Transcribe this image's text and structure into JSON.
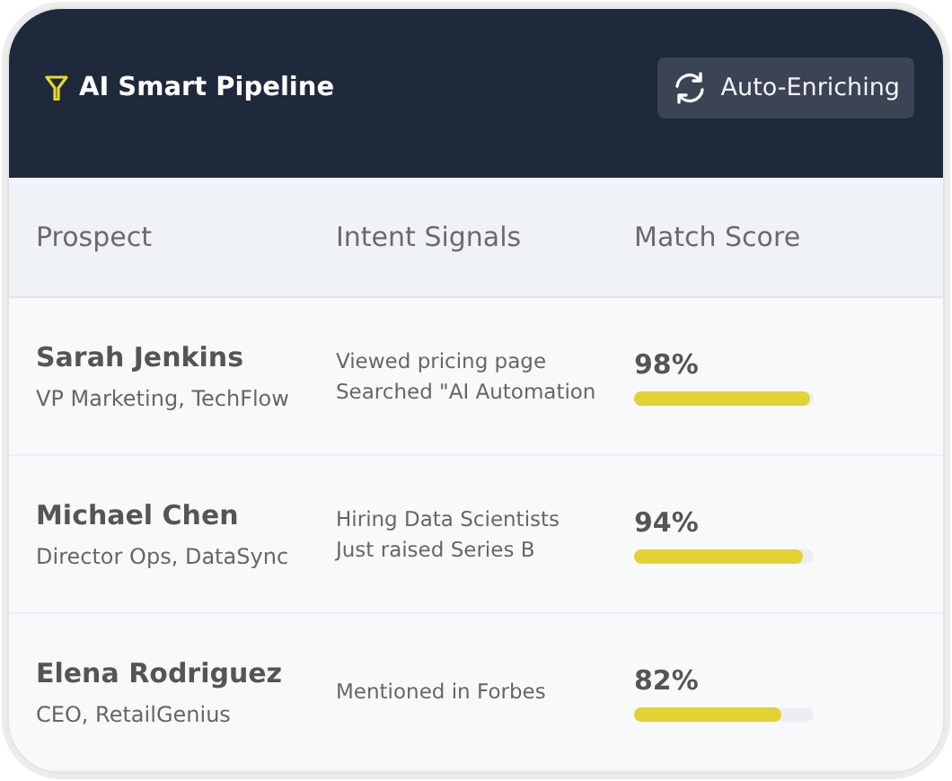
{
  "header": {
    "title": "AI Smart Pipeline",
    "status_button": "Auto-Enriching"
  },
  "table": {
    "columns": [
      "Prospect",
      "Intent Signals",
      "Match Score"
    ],
    "rows": [
      {
        "name": "Sarah Jenkins",
        "role": "VP Marketing, TechFlow",
        "signals": [
          "Viewed pricing page",
          "Searched \"AI Automation"
        ],
        "score": "98%",
        "level": 0.98
      },
      {
        "name": "Michael Chen",
        "role": "Director Ops, DataSync",
        "signals": [
          "Hiring Data Scientists",
          "Just raised Series B"
        ],
        "score": "94%",
        "level": 0.94
      },
      {
        "name": "Elena Rodriguez",
        "role": "CEO, RetailGenius",
        "signals": [
          "Mentioned in Forbes"
        ],
        "score": "82%",
        "level": 0.82
      }
    ]
  }
}
